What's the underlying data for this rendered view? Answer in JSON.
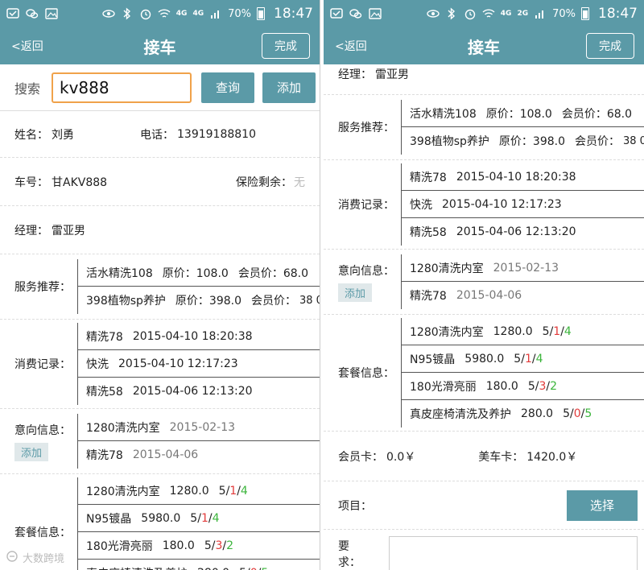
{
  "status_bar": {
    "network_4g": "4G",
    "network_4g_2": "4G",
    "network_2g": "2G",
    "battery": "70%",
    "time": "18:47"
  },
  "header": {
    "back_label": "<返回",
    "title": "接车",
    "done_label": "完成"
  },
  "search": {
    "label": "搜索",
    "value": "kv888",
    "query_button": "查询",
    "add_button": "添加"
  },
  "customer": {
    "name_label": "姓名：",
    "name": "刘勇",
    "phone_label": "电话：",
    "phone": "13919188810",
    "plate_label": "车号：",
    "plate": "甘AKV888",
    "insurance_label": "保险剩余：",
    "insurance": "无",
    "manager_label": "经理：",
    "manager": "雷亚男"
  },
  "service_recommend": {
    "label": "服务推荐：",
    "items": [
      {
        "name": "活水精洗108",
        "orig": "原价：108.0",
        "member": "会员价：68.0"
      },
      {
        "name": "398植物sp养护",
        "orig": "原价：398.0",
        "member": "会员价：",
        "member_tail": "38 0"
      }
    ]
  },
  "consumption": {
    "label": "消费记录：",
    "items": [
      {
        "name": "精洗78",
        "time": "2015-04-10 18:20:38"
      },
      {
        "name": "快洗",
        "time": "2015-04-10 12:17:23"
      },
      {
        "name": "精洗58",
        "time": "2015-04-06 12:13:20"
      }
    ]
  },
  "intention": {
    "label": "意向信息：",
    "add_label": "添加",
    "items": [
      {
        "name": "1280清洗内室",
        "date": "2015-02-13"
      },
      {
        "name": "精洗78",
        "date": "2015-04-06"
      }
    ]
  },
  "packages": {
    "label": "套餐信息：",
    "items": [
      {
        "name": "1280清洗内室",
        "price": "1280.0",
        "total": "5",
        "used": "1",
        "left": "4"
      },
      {
        "name": "N95镀晶",
        "price": "5980.0",
        "total": "5",
        "used": "1",
        "left": "4"
      },
      {
        "name": "180光滑亮丽",
        "price": "180.0",
        "total": "5",
        "used": "3",
        "left": "2"
      },
      {
        "name": "真皮座椅清洗及养护",
        "price": "280.0",
        "total": "5",
        "used": "0",
        "left": "5"
      }
    ]
  },
  "cards": {
    "member_card_label": "会员卡：",
    "member_card": "0.0￥",
    "car_card_label": "美车卡：",
    "car_card": "1420.0￥"
  },
  "project": {
    "label": "项目：",
    "select_button": "选择"
  },
  "requirement": {
    "label": "要求："
  },
  "watermark": {
    "text": "大数跨境"
  }
}
